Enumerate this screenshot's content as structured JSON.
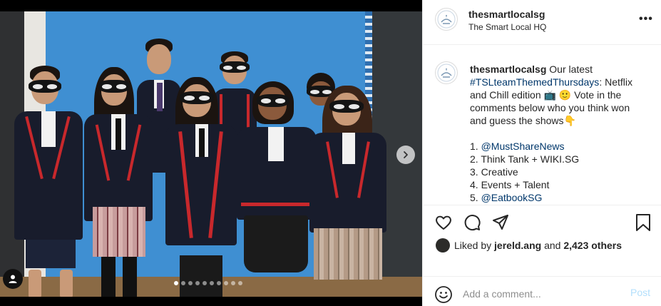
{
  "post": {
    "username": "thesmartlocalsg",
    "location": "The Smart Local HQ",
    "more_label": "•••"
  },
  "caption": {
    "username": "thesmartlocalsg",
    "text_intro": "Our latest",
    "hashtag": "#TSLteamThemedThursdays",
    "text_edition": ": Netflix and Chill edition",
    "emoji_tv": "📺",
    "emoji_smile": "🙂",
    "text_vote": "Vote in the comments below who you think won and guess the shows",
    "emoji_point": "👇",
    "list": [
      {
        "num": "1.",
        "text": "@MustShareNews",
        "is_link": true
      },
      {
        "num": "2.",
        "text": "Think Tank + WIKI.SG",
        "is_link": false
      },
      {
        "num": "3.",
        "text": "Creative",
        "is_link": false
      },
      {
        "num": "4.",
        "text": "Events + Talent",
        "is_link": false
      },
      {
        "num": "5.",
        "text": "@EatbookSG",
        "is_link": true
      }
    ]
  },
  "likes": {
    "prefix": "Liked by",
    "user": "jereld.ang",
    "and": "and",
    "others": "2,423 others"
  },
  "comment": {
    "placeholder": "Add a comment...",
    "post_label": "Post"
  },
  "carousel": {
    "total_slides": 10,
    "active_index": 0
  },
  "icons": {
    "like": "heart-icon",
    "comment": "comment-icon",
    "share": "share-icon",
    "save": "bookmark-icon",
    "next": "chevron-right-icon",
    "user_tag": "user-icon",
    "emoji": "emoji-icon",
    "more": "more-dots-icon"
  },
  "colors": {
    "link": "#00376b",
    "post_disabled": "#b2dffc",
    "backdrop": "#3f8fd2",
    "uniform_trim": "#c8282c"
  }
}
